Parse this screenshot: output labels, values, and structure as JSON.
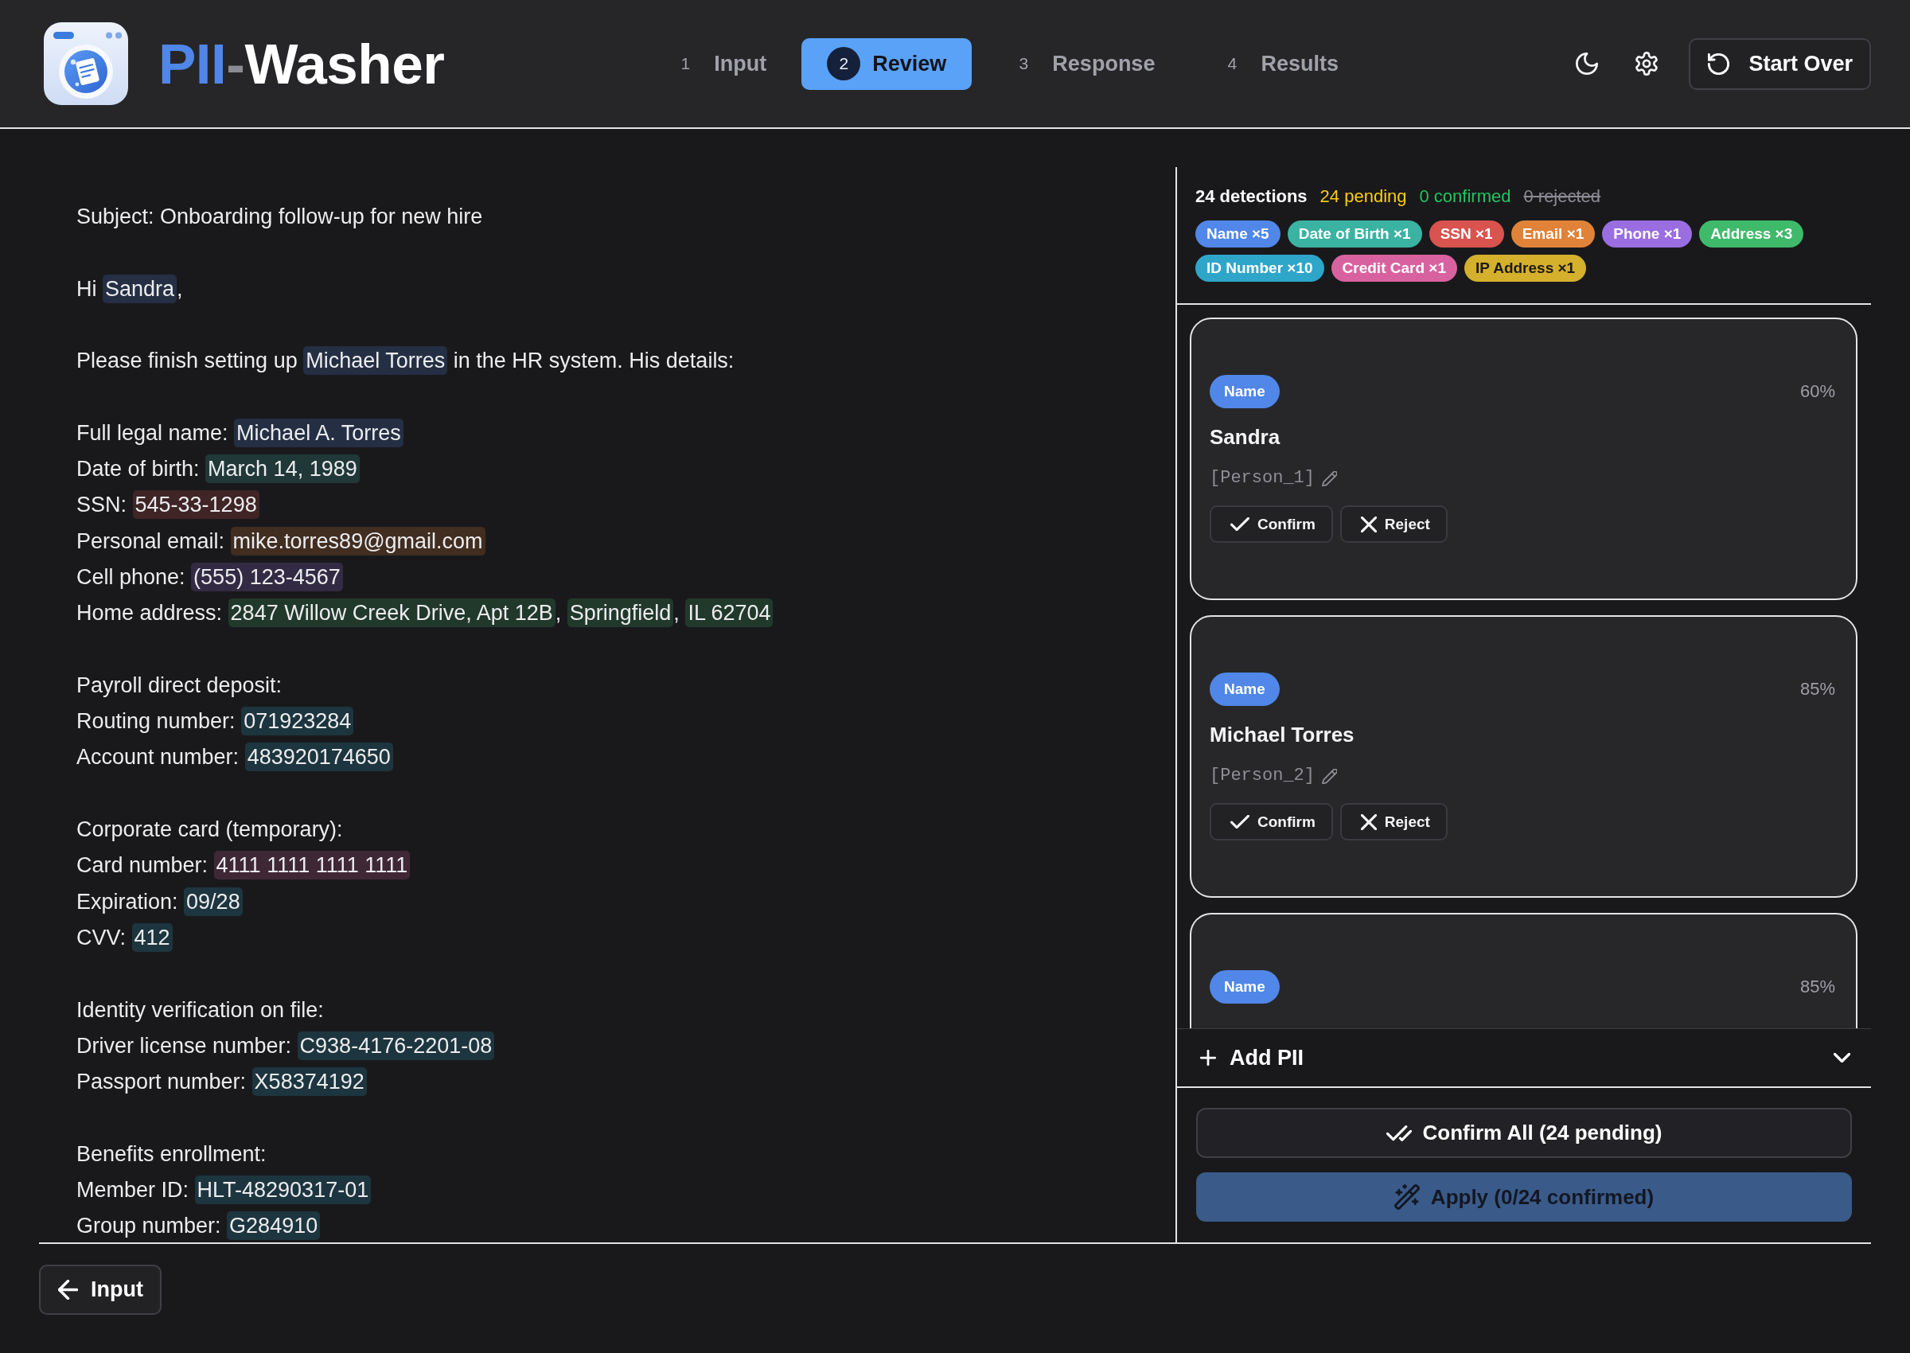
{
  "header": {
    "title_parts": [
      {
        "text": "PII",
        "color": "#4f86e8"
      },
      {
        "text": "-",
        "color": "#8b8b93"
      },
      {
        "text": "Washer",
        "color": "#ffffff"
      }
    ],
    "steps": [
      {
        "number": "1",
        "label": "Input",
        "selected": false
      },
      {
        "number": "2",
        "label": "Review",
        "selected": true
      },
      {
        "number": "3",
        "label": "Response",
        "selected": false
      },
      {
        "number": "4",
        "label": "Results",
        "selected": false
      }
    ],
    "start_over": "Start Over"
  },
  "document": {
    "paragraphs": [
      [
        [
          {
            "kind": "plain",
            "text": "Subject: Onboarding follow-up for new hire"
          }
        ]
      ],
      [
        [
          {
            "kind": "plain",
            "text": "Hi "
          },
          {
            "kind": "name",
            "text": "Sandra"
          },
          {
            "kind": "plain",
            "text": ","
          }
        ]
      ],
      [
        [
          {
            "kind": "plain",
            "text": "Please finish setting up "
          },
          {
            "kind": "name",
            "text": "Michael Torres"
          },
          {
            "kind": "plain",
            "text": " in the HR system. His details:"
          }
        ]
      ],
      [
        [
          {
            "kind": "plain",
            "text": "Full legal name: "
          },
          {
            "kind": "name",
            "text": "Michael A. Torres"
          }
        ],
        [
          {
            "kind": "plain",
            "text": "Date of birth: "
          },
          {
            "kind": "date_of_birth",
            "text": "March 14, 1989"
          }
        ],
        [
          {
            "kind": "plain",
            "text": "SSN: "
          },
          {
            "kind": "ssn",
            "text": "545-33-1298"
          }
        ],
        [
          {
            "kind": "plain",
            "text": "Personal email: "
          },
          {
            "kind": "email",
            "text": "mike.torres89@gmail.com"
          }
        ],
        [
          {
            "kind": "plain",
            "text": "Cell phone: "
          },
          {
            "kind": "phone",
            "text": "(555) 123-4567"
          }
        ],
        [
          {
            "kind": "plain",
            "text": "Home address: "
          },
          {
            "kind": "address",
            "text": "2847 Willow Creek Drive, Apt 12B"
          },
          {
            "kind": "plain",
            "text": ", "
          },
          {
            "kind": "address",
            "text": "Springfield"
          },
          {
            "kind": "plain",
            "text": ", "
          },
          {
            "kind": "address",
            "text": "IL 62704"
          }
        ]
      ],
      [
        [
          {
            "kind": "plain",
            "text": "Payroll direct deposit:"
          }
        ],
        [
          {
            "kind": "plain",
            "text": "Routing number: "
          },
          {
            "kind": "id_number",
            "text": "071923284"
          }
        ],
        [
          {
            "kind": "plain",
            "text": "Account number: "
          },
          {
            "kind": "id_number",
            "text": "483920174650"
          }
        ]
      ],
      [
        [
          {
            "kind": "plain",
            "text": "Corporate card (temporary):"
          }
        ],
        [
          {
            "kind": "plain",
            "text": "Card number: "
          },
          {
            "kind": "credit_card",
            "text": "4111 1111 1111 1111"
          }
        ],
        [
          {
            "kind": "plain",
            "text": "Expiration: "
          },
          {
            "kind": "id_number",
            "text": "09/28"
          }
        ],
        [
          {
            "kind": "plain",
            "text": "CVV: "
          },
          {
            "kind": "id_number",
            "text": "412"
          }
        ]
      ],
      [
        [
          {
            "kind": "plain",
            "text": "Identity verification on file:"
          }
        ],
        [
          {
            "kind": "plain",
            "text": "Driver license number: "
          },
          {
            "kind": "id_number",
            "text": "C938-4176-2201-08"
          }
        ],
        [
          {
            "kind": "plain",
            "text": "Passport number: "
          },
          {
            "kind": "id_number",
            "text": "X58374192"
          }
        ]
      ],
      [
        [
          {
            "kind": "plain",
            "text": "Benefits enrollment:"
          }
        ],
        [
          {
            "kind": "plain",
            "text": "Member ID: "
          },
          {
            "kind": "id_number",
            "text": "HLT-48290317-01"
          }
        ],
        [
          {
            "kind": "plain",
            "text": "Group number: "
          },
          {
            "kind": "id_number",
            "text": "G284910"
          }
        ]
      ]
    ]
  },
  "review": {
    "summary": [
      {
        "kind": "total",
        "text": "24 detections"
      },
      {
        "kind": "pending",
        "text": "24 pending"
      },
      {
        "kind": "confirmed",
        "text": "0 confirmed"
      },
      {
        "kind": "rejected",
        "text": "0 rejected"
      }
    ],
    "types": [
      {
        "kind": "name",
        "label": "Name ×5",
        "color": "#5087e8"
      },
      {
        "kind": "date_of_birth",
        "label": "Date of Birth ×1",
        "color": "#3bb3a3"
      },
      {
        "kind": "ssn",
        "label": "SSN ×1",
        "color": "#d9534f"
      },
      {
        "kind": "email",
        "label": "Email ×1",
        "color": "#e08338"
      },
      {
        "kind": "phone",
        "label": "Phone ×1",
        "color": "#9a6ee0"
      },
      {
        "kind": "address",
        "label": "Address ×3",
        "color": "#3fba6a"
      },
      {
        "kind": "id_number",
        "label": "ID Number ×10",
        "color": "#2ea6c9"
      },
      {
        "kind": "credit_card",
        "label": "Credit Card ×1",
        "color": "#d8629f"
      },
      {
        "kind": "ip_address",
        "label": "IP Address ×1",
        "color": "#d4b02c"
      }
    ],
    "cards": [
      {
        "kind": "name",
        "type_label": "Name",
        "confidence": "60%",
        "value": "Sandra",
        "replacement": "[Person_1]",
        "confirm": "Confirm",
        "reject": "Reject"
      },
      {
        "kind": "name",
        "type_label": "Name",
        "confidence": "85%",
        "value": "Michael Torres",
        "replacement": "[Person_2]",
        "confirm": "Confirm",
        "reject": "Reject"
      },
      {
        "kind": "name",
        "type_label": "Name",
        "confidence": "85%"
      }
    ],
    "add_pii": {
      "label": "Add PII",
      "expanded": false
    },
    "confirm_all": "Confirm All (24 pending)",
    "apply": {
      "label": "Apply (0/24 confirmed)",
      "disabled": true
    }
  },
  "footer": {
    "back": "Input"
  }
}
